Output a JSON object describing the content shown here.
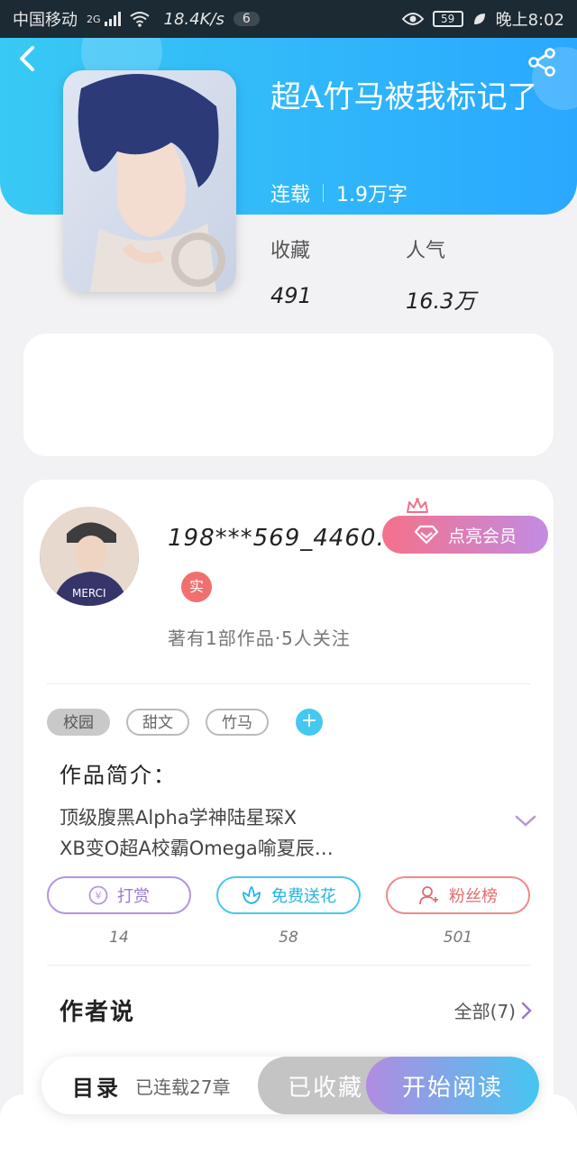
{
  "status_bar": {
    "carrier": "中国移动",
    "network": "2G",
    "speed": "18.4K/s",
    "notif_count": "6",
    "battery": "59",
    "time": "晚上8:02"
  },
  "book": {
    "title": "超A竹马被我标记了",
    "status": "连载",
    "word_count": "1.9万字",
    "favorites_label": "收藏",
    "favorites": "491",
    "popularity_label": "人气",
    "popularity": "16.3万"
  },
  "author": {
    "name": "198***569_4460…",
    "real_badge": "实",
    "vip_button": "点亮会员",
    "works_info": "著有1部作品·5人关注"
  },
  "tags": [
    "校园",
    "甜文",
    "竹马"
  ],
  "intro": {
    "label": "作品简介：",
    "line1": "顶级腹黑Alpha学神陆星琛X",
    "line2": "XB变O超A校霸Omega喻夏辰…"
  },
  "actions": {
    "reward": {
      "label": "打赏",
      "count": "14",
      "symbol": "¥"
    },
    "flower": {
      "label": "免费送花",
      "count": "58"
    },
    "fans": {
      "label": "粉丝榜",
      "count": "501"
    }
  },
  "author_says": {
    "label": "作者说",
    "all": "全部(7)"
  },
  "bottom_bar": {
    "toc": "目录",
    "serial_count": "已连载27章",
    "collected": "已收藏",
    "start_reading": "开始阅读"
  },
  "colors": {
    "header_start": "#38c9f4",
    "header_end": "#2aa8ff",
    "vip_start": "#f5718a",
    "vip_end": "#c18ce3",
    "accent_purple": "#9b78d4",
    "accent_blue": "#44c8f0"
  },
  "icons": [
    "back-icon",
    "share-icon",
    "crown-icon",
    "diamond-icon",
    "yuan-icon",
    "flower-icon",
    "fans-icon",
    "chevron-down-icon",
    "chevron-right-icon"
  ]
}
